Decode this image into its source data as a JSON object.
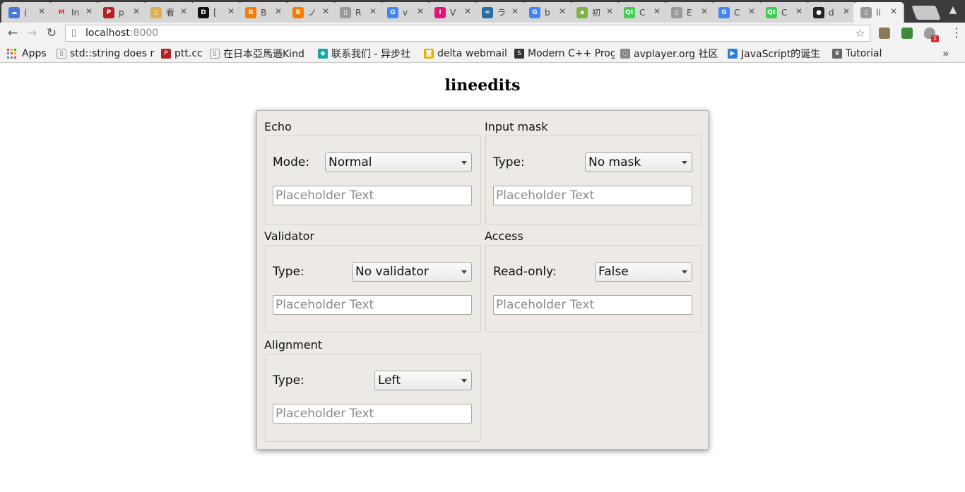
{
  "browser": {
    "tabs": [
      {
        "fav_text": "☁",
        "fav_color": "#4a78d8",
        "title": "(",
        "close": "✕"
      },
      {
        "fav_text": "M",
        "fav_color": "#ffffff",
        "title": "In",
        "close": "✕"
      },
      {
        "fav_text": "P",
        "fav_color": "#b32222",
        "title": "p",
        "close": "✕"
      },
      {
        "fav_text": "▯",
        "fav_color": "#e0b050",
        "title": "看",
        "close": "✕"
      },
      {
        "fav_text": "D",
        "fav_color": "#111111",
        "title": "[",
        "close": "✕"
      },
      {
        "fav_text": "B",
        "fav_color": "#f57d00",
        "title": "B",
        "close": "✕"
      },
      {
        "fav_text": "B",
        "fav_color": "#f57d00",
        "title": "ノ",
        "close": "✕"
      },
      {
        "fav_text": "▯",
        "fav_color": "#9a9a9a",
        "title": "R",
        "close": "✕"
      },
      {
        "fav_text": "G",
        "fav_color": "#4285f4",
        "title": "v",
        "close": "✕"
      },
      {
        "fav_text": "!",
        "fav_color": "#e0157a",
        "title": "V",
        "close": "✕"
      },
      {
        "fav_text": "≈",
        "fav_color": "#2a6ea0",
        "title": "ラ",
        "close": "✕"
      },
      {
        "fav_text": "G",
        "fav_color": "#4285f4",
        "title": "b",
        "close": "✕"
      },
      {
        "fav_text": "▪",
        "fav_color": "#7cb342",
        "title": "初",
        "close": "✕"
      },
      {
        "fav_text": "Qt",
        "fav_color": "#41cd52",
        "title": "C",
        "close": "✕"
      },
      {
        "fav_text": "▯",
        "fav_color": "#9a9a9a",
        "title": "E",
        "close": "✕"
      },
      {
        "fav_text": "G",
        "fav_color": "#4285f4",
        "title": "C",
        "close": "✕"
      },
      {
        "fav_text": "Qt",
        "fav_color": "#41cd52",
        "title": "C",
        "close": "✕"
      },
      {
        "fav_text": "●",
        "fav_color": "#222222",
        "title": "d",
        "close": "✕"
      },
      {
        "fav_text": "▯",
        "fav_color": "#9a9a9a",
        "title": "li",
        "close": "✕"
      }
    ],
    "nav": {
      "back": "←",
      "forward": "→",
      "reload": "↻"
    },
    "address": {
      "host": "localhost",
      "port": ":8000",
      "page_icon": "▯",
      "star": "☆"
    },
    "extensions": {
      "badge": "1",
      "menu": "⋮"
    },
    "bookmarks": [
      {
        "label": "Apps",
        "icon": "apps-grid"
      },
      {
        "label": "std::string does r",
        "icon_text": "▯",
        "icon_color": "#ffffff"
      },
      {
        "label": "ptt.cc",
        "icon_text": "P",
        "icon_color": "#b32222"
      },
      {
        "label": "在日本亞馬遜Kind",
        "icon_text": "▯",
        "icon_color": "#ffffff"
      },
      {
        "label": "联系我们 - 异步社",
        "icon_text": "◆",
        "icon_color": "#1aa5a0"
      },
      {
        "label": "delta webmail",
        "icon_text": "◙",
        "icon_color": "#e2b400"
      },
      {
        "label": "Modern C++ Prog",
        "icon_text": "S",
        "icon_color": "#333333"
      },
      {
        "label": "avplayer.org 社区",
        "icon_text": "◌",
        "icon_color": "#888888"
      },
      {
        "label": "JavaScript的诞生",
        "icon_text": "▶",
        "icon_color": "#2b7de0"
      },
      {
        "label": "Tutorial",
        "icon_text": "♛",
        "icon_color": "#666666"
      }
    ],
    "bookmarks_more": "»"
  },
  "page": {
    "title": "lineedits",
    "groups": {
      "echo": {
        "title": "Echo",
        "label": "Mode:",
        "value": "Normal",
        "placeholder": "Placeholder Text"
      },
      "input_mask": {
        "title": "Input mask",
        "label": "Type:",
        "value": "No mask",
        "placeholder": "Placeholder Text"
      },
      "validator": {
        "title": "Validator",
        "label": "Type:",
        "value": "No validator",
        "placeholder": "Placeholder Text"
      },
      "access": {
        "title": "Access",
        "label": "Read-only:",
        "value": "False",
        "placeholder": "Placeholder Text"
      },
      "alignment": {
        "title": "Alignment",
        "label": "Type:",
        "value": "Left",
        "placeholder": "Placeholder Text"
      }
    }
  }
}
